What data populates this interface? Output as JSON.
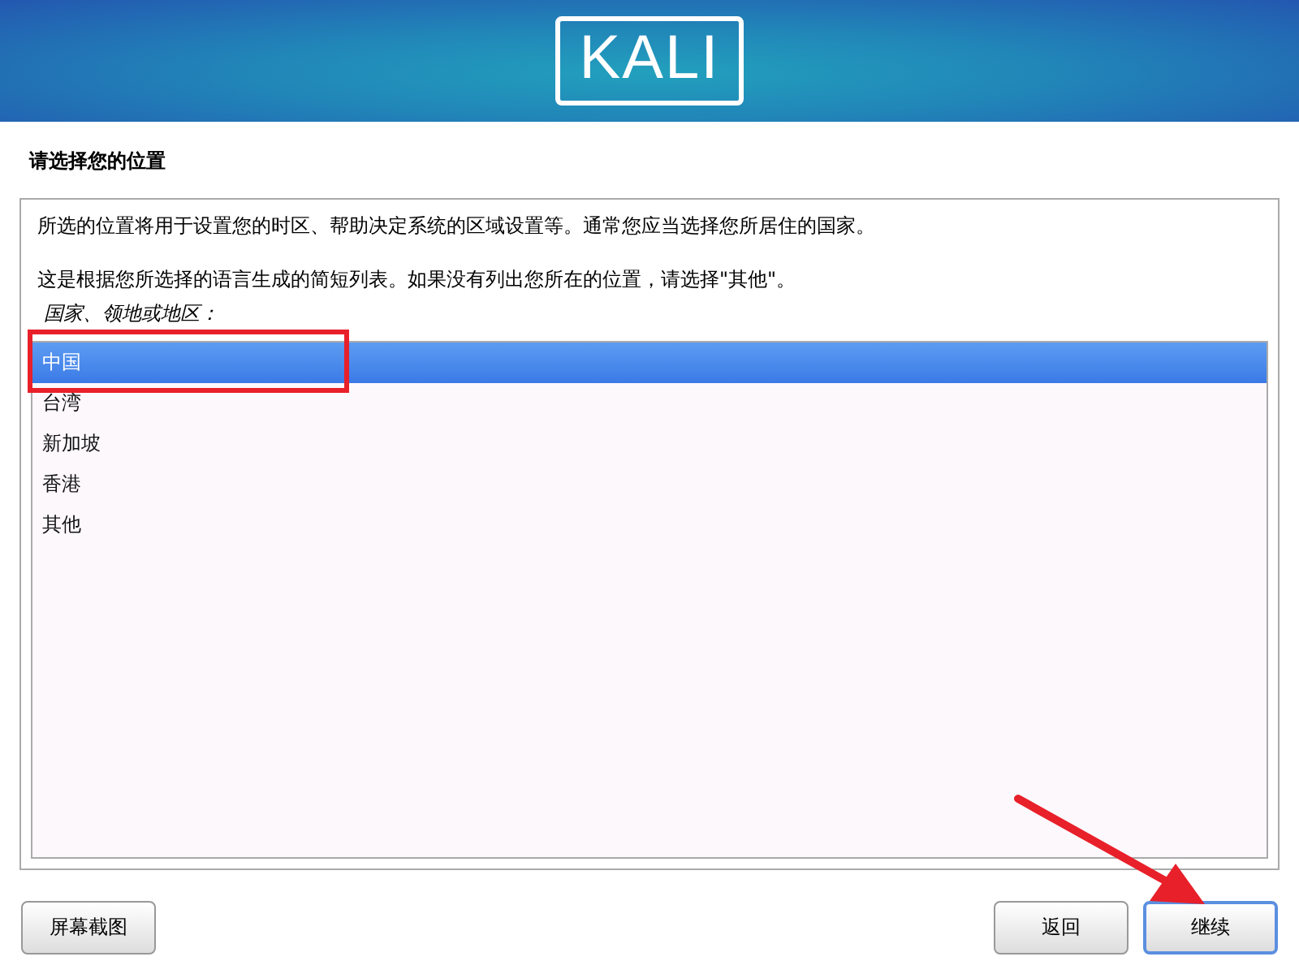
{
  "header": {
    "logo": "KALI"
  },
  "title": "请选择您的位置",
  "paragraphs": [
    "所选的位置将用于设置您的时区、帮助决定系统的区域设置等。通常您应当选择您所居住的国家。",
    "这是根据您所选择的语言生成的简短列表。如果没有列出您所在的位置，请选择\"其他\"。"
  ],
  "list_label": "国家、领地或地区：",
  "items": [
    {
      "label": "中国",
      "selected": true
    },
    {
      "label": "台湾",
      "selected": false
    },
    {
      "label": "新加坡",
      "selected": false
    },
    {
      "label": "香港",
      "selected": false
    },
    {
      "label": "其他",
      "selected": false
    }
  ],
  "buttons": [
    {
      "label": "屏幕截图",
      "kind": "left",
      "focused": false
    },
    {
      "label": "返回",
      "kind": "right",
      "focused": false
    },
    {
      "label": "继续",
      "kind": "right",
      "focused": true
    }
  ]
}
